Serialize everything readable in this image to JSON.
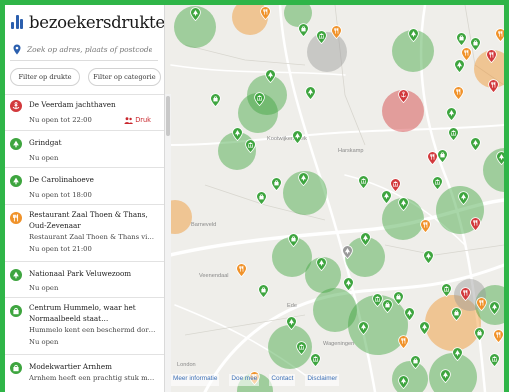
{
  "brand": {
    "name": "bezoekersdrukte",
    "accent": "#2b5fae"
  },
  "search": {
    "placeholder": "Zoek op adres, plaats of postcode",
    "icon": "location-pin-icon"
  },
  "filters": {
    "crowd_label": "Filter op drukte",
    "category_label": "Filter op categorie"
  },
  "colors": {
    "quiet": "#3ea53f",
    "busy": "#f0922a",
    "very_busy": "#d2393c",
    "unknown": "#9a9a9a",
    "frame": "#2fb548"
  },
  "locations": [
    {
      "title": "De Veerdam jachthaven",
      "subtitle": "",
      "status": "Nu open tot 22:00",
      "badge": "Druk",
      "crowd": "very_busy",
      "icon": "anchor-icon"
    },
    {
      "title": "Grindgat",
      "subtitle": "",
      "status": "Nu open",
      "badge": "",
      "crowd": "quiet",
      "icon": "tree-icon"
    },
    {
      "title": "De Carolinahoeve",
      "subtitle": "",
      "status": "Nu open tot 18:00",
      "badge": "",
      "crowd": "quiet",
      "icon": "tree-icon"
    },
    {
      "title": "Restaurant Zaal Thoen & Thans, Oud-Zevenaar",
      "subtitle": "Restaurant Zaal Thoen & Thans vi…",
      "status": "Nu open tot 21:00",
      "badge": "",
      "crowd": "busy",
      "icon": "restaurant-icon"
    },
    {
      "title": "Nationaal Park Veluwezoom",
      "subtitle": "",
      "status": "Nu open",
      "badge": "",
      "crowd": "quiet",
      "icon": "tree-icon"
    },
    {
      "title": "Centrum Hummelo, waar het Normaalbeeld staat…",
      "subtitle": "Hummelo kent een beschermd dor…",
      "status": "Nu open",
      "badge": "",
      "crowd": "quiet",
      "icon": "shop-icon"
    },
    {
      "title": "Modekwartier Arnhem",
      "subtitle": "Arnhem heeft een prachtig stuk m…",
      "status": "",
      "badge": "",
      "crowd": "quiet",
      "icon": "shop-icon"
    }
  ],
  "map": {
    "places": [
      "Kootwijkerbroek",
      "Harskamp",
      "Barneveld",
      "Veenendaal",
      "Ede",
      "Wageningen",
      "London"
    ],
    "heat_circles": [
      {
        "lon": 190,
        "lat": 22,
        "r": 21,
        "crowd": "quiet"
      },
      {
        "lon": 245,
        "lat": 12,
        "r": 18,
        "crowd": "busy"
      },
      {
        "lon": 293,
        "lat": 8,
        "r": 14,
        "crowd": "quiet"
      },
      {
        "lon": 322,
        "lat": 47,
        "r": 20,
        "crowd": "unknown"
      },
      {
        "lon": 262,
        "lat": 90,
        "r": 20,
        "crowd": "quiet"
      },
      {
        "lon": 253,
        "lat": 108,
        "r": 20,
        "crowd": "quiet"
      },
      {
        "lon": 232,
        "lat": 146,
        "r": 19,
        "crowd": "quiet"
      },
      {
        "lon": 300,
        "lat": 188,
        "r": 22,
        "crowd": "quiet"
      },
      {
        "lon": 170,
        "lat": 212,
        "r": 17,
        "crowd": "busy"
      },
      {
        "lon": 398,
        "lat": 106,
        "r": 21,
        "crowd": "very_busy"
      },
      {
        "lon": 408,
        "lat": 46,
        "r": 21,
        "crowd": "quiet"
      },
      {
        "lon": 488,
        "lat": 64,
        "r": 19,
        "crowd": "busy"
      },
      {
        "lon": 500,
        "lat": 165,
        "r": 22,
        "crowd": "quiet"
      },
      {
        "lon": 455,
        "lat": 205,
        "r": 24,
        "crowd": "quiet"
      },
      {
        "lon": 398,
        "lat": 214,
        "r": 21,
        "crowd": "quiet"
      },
      {
        "lon": 360,
        "lat": 252,
        "r": 20,
        "crowd": "quiet"
      },
      {
        "lon": 287,
        "lat": 252,
        "r": 20,
        "crowd": "quiet"
      },
      {
        "lon": 318,
        "lat": 270,
        "r": 18,
        "crowd": "quiet"
      },
      {
        "lon": 330,
        "lat": 305,
        "r": 22,
        "crowd": "quiet"
      },
      {
        "lon": 373,
        "lat": 320,
        "r": 30,
        "crowd": "quiet"
      },
      {
        "lon": 448,
        "lat": 318,
        "r": 28,
        "crowd": "busy"
      },
      {
        "lon": 285,
        "lat": 342,
        "r": 22,
        "crowd": "quiet"
      },
      {
        "lon": 448,
        "lat": 372,
        "r": 24,
        "crowd": "quiet"
      },
      {
        "lon": 405,
        "lat": 374,
        "r": 18,
        "crowd": "quiet"
      },
      {
        "lon": 250,
        "lat": 386,
        "r": 18,
        "crowd": "quiet"
      },
      {
        "lon": 490,
        "lat": 300,
        "r": 20,
        "crowd": "quiet"
      },
      {
        "lon": 465,
        "lat": 290,
        "r": 16,
        "crowd": "unknown"
      }
    ],
    "markers": [
      {
        "lon": 190,
        "lat": 16,
        "crowd": "quiet",
        "icon": "tree-icon"
      },
      {
        "lon": 260,
        "lat": 15,
        "crowd": "busy",
        "icon": "restaurant-icon"
      },
      {
        "lon": 298,
        "lat": 32,
        "crowd": "quiet",
        "icon": "shop-icon"
      },
      {
        "lon": 316,
        "lat": 39,
        "crowd": "quiet",
        "icon": "museum-icon"
      },
      {
        "lon": 331,
        "lat": 34,
        "crowd": "busy",
        "icon": "restaurant-icon"
      },
      {
        "lon": 408,
        "lat": 37,
        "crowd": "quiet",
        "icon": "tree-icon"
      },
      {
        "lon": 456,
        "lat": 41,
        "crowd": "quiet",
        "icon": "shop-icon"
      },
      {
        "lon": 470,
        "lat": 46,
        "crowd": "quiet",
        "icon": "shop-icon"
      },
      {
        "lon": 461,
        "lat": 56,
        "crowd": "busy",
        "icon": "restaurant-icon"
      },
      {
        "lon": 495,
        "lat": 37,
        "crowd": "busy",
        "icon": "restaurant-icon"
      },
      {
        "lon": 486,
        "lat": 58,
        "crowd": "very_busy",
        "icon": "restaurant-icon"
      },
      {
        "lon": 454,
        "lat": 68,
        "crowd": "quiet",
        "icon": "tree-icon"
      },
      {
        "lon": 265,
        "lat": 78,
        "crowd": "quiet",
        "icon": "tree-icon"
      },
      {
        "lon": 210,
        "lat": 102,
        "crowd": "quiet",
        "icon": "shop-icon"
      },
      {
        "lon": 254,
        "lat": 101,
        "crowd": "quiet",
        "icon": "museum-icon"
      },
      {
        "lon": 305,
        "lat": 95,
        "crowd": "quiet",
        "icon": "tree-icon"
      },
      {
        "lon": 398,
        "lat": 98,
        "crowd": "very_busy",
        "icon": "anchor-icon"
      },
      {
        "lon": 453,
        "lat": 95,
        "crowd": "busy",
        "icon": "restaurant-icon"
      },
      {
        "lon": 488,
        "lat": 88,
        "crowd": "very_busy",
        "icon": "restaurant-icon"
      },
      {
        "lon": 446,
        "lat": 116,
        "crowd": "quiet",
        "icon": "tree-icon"
      },
      {
        "lon": 232,
        "lat": 136,
        "crowd": "quiet",
        "icon": "tree-icon"
      },
      {
        "lon": 245,
        "lat": 148,
        "crowd": "quiet",
        "icon": "museum-icon"
      },
      {
        "lon": 292,
        "lat": 139,
        "crowd": "quiet",
        "icon": "tree-icon"
      },
      {
        "lon": 448,
        "lat": 136,
        "crowd": "quiet",
        "icon": "museum-icon"
      },
      {
        "lon": 470,
        "lat": 146,
        "crowd": "quiet",
        "icon": "tree-icon"
      },
      {
        "lon": 496,
        "lat": 160,
        "crowd": "quiet",
        "icon": "tree-icon"
      },
      {
        "lon": 427,
        "lat": 160,
        "crowd": "very_busy",
        "icon": "restaurant-icon"
      },
      {
        "lon": 437,
        "lat": 158,
        "crowd": "quiet",
        "icon": "shop-icon"
      },
      {
        "lon": 271,
        "lat": 186,
        "crowd": "quiet",
        "icon": "shop-icon"
      },
      {
        "lon": 298,
        "lat": 181,
        "crowd": "quiet",
        "icon": "tree-icon"
      },
      {
        "lon": 358,
        "lat": 184,
        "crowd": "quiet",
        "icon": "museum-icon"
      },
      {
        "lon": 390,
        "lat": 187,
        "crowd": "very_busy",
        "icon": "museum-icon"
      },
      {
        "lon": 381,
        "lat": 199,
        "crowd": "quiet",
        "icon": "tree-icon"
      },
      {
        "lon": 432,
        "lat": 185,
        "crowd": "quiet",
        "icon": "museum-icon"
      },
      {
        "lon": 458,
        "lat": 200,
        "crowd": "quiet",
        "icon": "tree-icon"
      },
      {
        "lon": 256,
        "lat": 200,
        "crowd": "quiet",
        "icon": "shop-icon"
      },
      {
        "lon": 398,
        "lat": 206,
        "crowd": "quiet",
        "icon": "tree-icon"
      },
      {
        "lon": 420,
        "lat": 228,
        "crowd": "busy",
        "icon": "restaurant-icon"
      },
      {
        "lon": 470,
        "lat": 226,
        "crowd": "very_busy",
        "icon": "restaurant-icon"
      },
      {
        "lon": 288,
        "lat": 242,
        "crowd": "quiet",
        "icon": "shop-icon"
      },
      {
        "lon": 360,
        "lat": 241,
        "crowd": "quiet",
        "icon": "tree-icon"
      },
      {
        "lon": 342,
        "lat": 254,
        "crowd": "unknown",
        "icon": "tree-icon"
      },
      {
        "lon": 423,
        "lat": 259,
        "crowd": "quiet",
        "icon": "tree-icon"
      },
      {
        "lon": 316,
        "lat": 266,
        "crowd": "quiet",
        "icon": "tree-icon"
      },
      {
        "lon": 236,
        "lat": 272,
        "crowd": "busy",
        "icon": "restaurant-icon"
      },
      {
        "lon": 258,
        "lat": 293,
        "crowd": "quiet",
        "icon": "shop-icon"
      },
      {
        "lon": 343,
        "lat": 286,
        "crowd": "quiet",
        "icon": "tree-icon"
      },
      {
        "lon": 372,
        "lat": 302,
        "crowd": "quiet",
        "icon": "museum-icon"
      },
      {
        "lon": 382,
        "lat": 308,
        "crowd": "quiet",
        "icon": "shop-icon"
      },
      {
        "lon": 393,
        "lat": 300,
        "crowd": "quiet",
        "icon": "shop-icon"
      },
      {
        "lon": 404,
        "lat": 316,
        "crowd": "quiet",
        "icon": "tree-icon"
      },
      {
        "lon": 441,
        "lat": 292,
        "crowd": "quiet",
        "icon": "museum-icon"
      },
      {
        "lon": 460,
        "lat": 296,
        "crowd": "very_busy",
        "icon": "restaurant-icon"
      },
      {
        "lon": 476,
        "lat": 306,
        "crowd": "busy",
        "icon": "restaurant-icon"
      },
      {
        "lon": 451,
        "lat": 316,
        "crowd": "quiet",
        "icon": "shop-icon"
      },
      {
        "lon": 489,
        "lat": 310,
        "crowd": "quiet",
        "icon": "tree-icon"
      },
      {
        "lon": 286,
        "lat": 325,
        "crowd": "quiet",
        "icon": "tree-icon"
      },
      {
        "lon": 358,
        "lat": 330,
        "crowd": "quiet",
        "icon": "tree-icon"
      },
      {
        "lon": 398,
        "lat": 344,
        "crowd": "busy",
        "icon": "restaurant-icon"
      },
      {
        "lon": 419,
        "lat": 330,
        "crowd": "quiet",
        "icon": "tree-icon"
      },
      {
        "lon": 474,
        "lat": 336,
        "crowd": "quiet",
        "icon": "shop-icon"
      },
      {
        "lon": 493,
        "lat": 338,
        "crowd": "busy",
        "icon": "restaurant-icon"
      },
      {
        "lon": 296,
        "lat": 350,
        "crowd": "quiet",
        "icon": "museum-icon"
      },
      {
        "lon": 310,
        "lat": 362,
        "crowd": "quiet",
        "icon": "museum-icon"
      },
      {
        "lon": 452,
        "lat": 356,
        "crowd": "quiet",
        "icon": "tree-icon"
      },
      {
        "lon": 410,
        "lat": 364,
        "crowd": "quiet",
        "icon": "shop-icon"
      },
      {
        "lon": 249,
        "lat": 380,
        "crowd": "busy",
        "icon": "restaurant-icon"
      },
      {
        "lon": 489,
        "lat": 362,
        "crowd": "quiet",
        "icon": "museum-icon"
      },
      {
        "lon": 440,
        "lat": 378,
        "crowd": "quiet",
        "icon": "tree-icon"
      },
      {
        "lon": 398,
        "lat": 384,
        "crowd": "quiet",
        "icon": "tree-icon"
      }
    ]
  },
  "footer": {
    "links": [
      "Meer informatie",
      "Doe mee",
      "Contact",
      "Disclaimer"
    ]
  }
}
